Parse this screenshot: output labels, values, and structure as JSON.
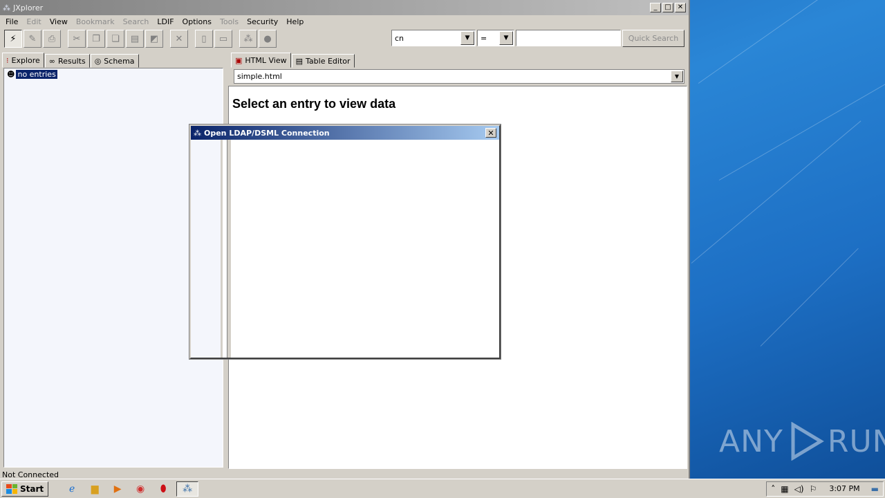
{
  "window": {
    "title": "JXplorer"
  },
  "menubar": {
    "items": [
      {
        "label": "File",
        "enabled": true
      },
      {
        "label": "Edit",
        "enabled": false
      },
      {
        "label": "View",
        "enabled": true
      },
      {
        "label": "Bookmark",
        "enabled": false
      },
      {
        "label": "Search",
        "enabled": false
      },
      {
        "label": "LDIF",
        "enabled": true
      },
      {
        "label": "Options",
        "enabled": true
      },
      {
        "label": "Tools",
        "enabled": false
      },
      {
        "label": "Security",
        "enabled": true
      },
      {
        "label": "Help",
        "enabled": true
      }
    ]
  },
  "toolbar": {
    "attribute_value": "cn",
    "operator_value": "=",
    "search_value": "",
    "quick_search_label": "Quick Search"
  },
  "left_pane": {
    "tabs": [
      {
        "label": "Explore",
        "icon": "tree-icon"
      },
      {
        "label": "Results",
        "icon": "binoculars-icon"
      },
      {
        "label": "Schema",
        "icon": "schema-icon"
      }
    ],
    "tree_root_label": "no entries"
  },
  "right_pane": {
    "tabs": [
      {
        "label": "HTML View",
        "icon": "html-doc-icon"
      },
      {
        "label": "Table Editor",
        "icon": "table-doc-icon"
      }
    ],
    "template_value": "simple.html",
    "heading": "Select an entry to view data"
  },
  "status": {
    "text": "Not Connected"
  },
  "dialog": {
    "title": "Open LDAP/DSML Connection"
  },
  "taskbar": {
    "start_label": "Start",
    "clock": "3:07 PM"
  },
  "desktop": {
    "watermark": "ANY RUN"
  },
  "colors": {
    "selection": "#0a246a",
    "chrome": "#d4d0c8",
    "desktop": "#1d6fc0"
  }
}
